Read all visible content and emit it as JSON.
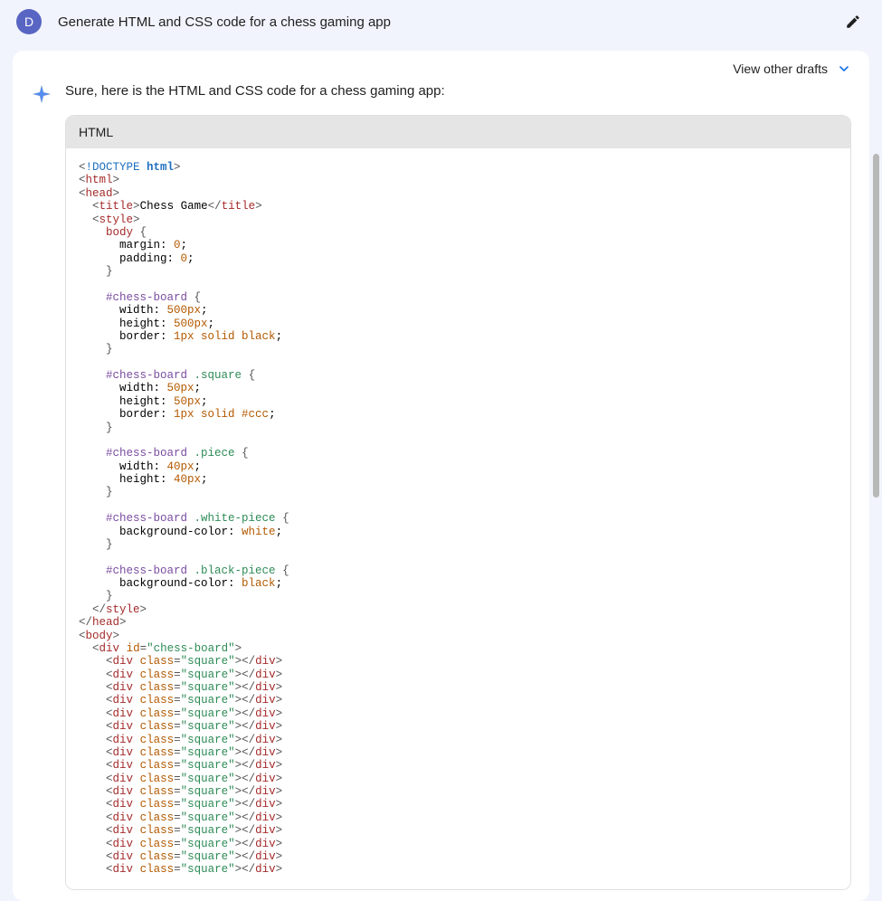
{
  "user": {
    "avatar_initial": "D",
    "prompt": "Generate HTML and CSS code for a chess gaming app"
  },
  "response": {
    "drafts_label": "View other drafts",
    "intro": "Sure, here is the HTML and CSS code for a chess gaming app:",
    "code_lang": "HTML",
    "code": {
      "doctype_prefix": "<!DOCTYPE ",
      "doctype_html": "html",
      "title_text": "Chess Game",
      "css_body_sel": "body",
      "css_body_rules": [
        "margin: 0;",
        "padding: 0;"
      ],
      "css_board_sel": "#chess-board",
      "css_board_rules": [
        {
          "p": "width",
          "v": "500px"
        },
        {
          "p": "height",
          "v": "500px"
        },
        {
          "p": "border",
          "v": "1px solid black"
        }
      ],
      "css_square_sel": "#chess-board .square",
      "css_square_rules": [
        {
          "p": "width",
          "v": "50px"
        },
        {
          "p": "height",
          "v": "50px"
        },
        {
          "p": "border",
          "v": "1px solid #ccc"
        }
      ],
      "css_piece_sel": "#chess-board .piece",
      "css_piece_rules": [
        {
          "p": "width",
          "v": "40px"
        },
        {
          "p": "height",
          "v": "40px"
        }
      ],
      "css_white_sel": "#chess-board .white-piece",
      "css_white_rules": [
        {
          "p": "background-color",
          "v": "white"
        }
      ],
      "css_black_sel": "#chess-board .black-piece",
      "css_black_rules": [
        {
          "p": "background-color",
          "v": "black"
        }
      ],
      "board_id": "chess-board",
      "square_class": "square",
      "square_count": 17
    }
  },
  "colors": {
    "page_bg": "#f1f4fc",
    "avatar_bg": "#5865c3",
    "code_header_bg": "#e5e5e5",
    "chevron": "#1a73e8"
  }
}
